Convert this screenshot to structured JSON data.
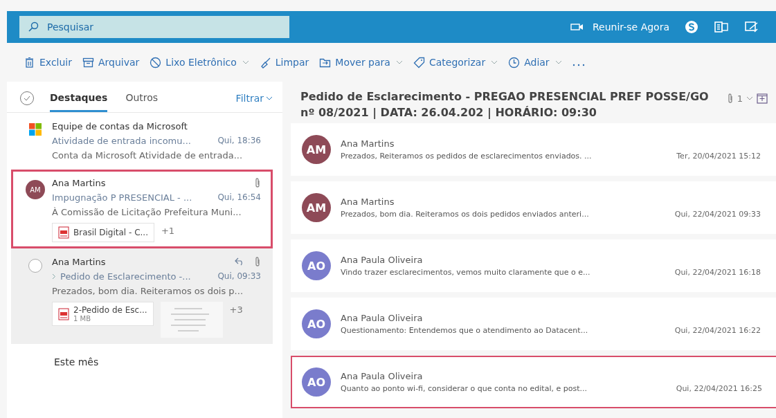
{
  "top_bar": {
    "search": {
      "placeholder": "Pesquisar"
    },
    "meet_now": "Reunir-se Agora"
  },
  "toolbar": [
    {
      "label": "Excluir",
      "caret": false
    },
    {
      "label": "Arquivar",
      "caret": false
    },
    {
      "label": "Lixo Eletrônico",
      "caret": true
    },
    {
      "label": "Limpar",
      "caret": false
    },
    {
      "label": "Mover para",
      "caret": true
    },
    {
      "label": "Categorizar",
      "caret": true
    },
    {
      "label": "Adiar",
      "caret": true
    }
  ],
  "message_list": {
    "tabs": [
      {
        "label": "Destaques",
        "selected": true
      },
      {
        "label": "Outros",
        "selected": false
      }
    ],
    "filter": "Filtrar",
    "items": [
      {
        "kind": "logo",
        "sender": "Equipe de contas da Microsoft",
        "subject": "Atividade de entrada incomu...",
        "time": "Qui, 18:36",
        "preview": "Conta da Microsoft Atividade de entrada...",
        "highlighted": false,
        "attachment": false,
        "replied": false
      },
      {
        "kind": "avatar",
        "initials": "AM",
        "color": "#8e4a57",
        "sender": "Ana Martins",
        "subject": "Impugnação P PRESENCIAL - ...",
        "time": "Qui, 16:54",
        "preview": "À Comissão de Licitação Prefeitura Muni...",
        "highlighted": true,
        "attachment": true,
        "replied": false,
        "files": [
          {
            "kind": "pdf",
            "name": "Brasil Digital - C..."
          }
        ],
        "more": "+1"
      },
      {
        "kind": "radio",
        "sender": "Ana Martins",
        "subject": "Pedido de Esclarecimento -...",
        "time": "Qui, 09:33",
        "preview": "Prezados, bom dia. Reiteramos os dois p...",
        "highlighted": false,
        "attachment": true,
        "replied": true,
        "files": [
          {
            "kind": "pdf",
            "name": "2-Pedido de Esc...",
            "size": "1 MB"
          },
          {
            "kind": "thumbnail"
          }
        ],
        "more": "+3"
      }
    ],
    "section": "Este mês"
  },
  "reading_pane": {
    "subject": "Pedido de Esclarecimento - PREGAO PRESENCIAL PREF POSSE/GO nº 08/2021 | DATA: 26.04.202 | HORÁRIO: 09:30",
    "attachment_count": "1",
    "messages": [
      {
        "initials": "AM",
        "color": "#8e4a57",
        "sender": "Ana Martins",
        "preview": "Prezados, Reiteramos os pedidos de esclarecimentos enviados. ...",
        "date": "Ter, 20/04/2021 15:12",
        "highlighted": false
      },
      {
        "initials": "AM",
        "color": "#8e4a57",
        "sender": "Ana Martins",
        "preview": "Prezados, bom dia. Reiteramos os dois pedidos enviados anteri...",
        "date": "Qui, 22/04/2021 09:33",
        "highlighted": false
      },
      {
        "initials": "AO",
        "color": "#7a7ccc",
        "sender": "Ana Paula Oliveira",
        "preview": "Vindo trazer esclarecimentos, vemos muito claramente que o e...",
        "date": "Qui, 22/04/2021 16:18",
        "highlighted": false
      },
      {
        "initials": "AO",
        "color": "#7a7ccc",
        "sender": "Ana Paula Oliveira",
        "preview": "Questionamento: Entendemos que o atendimento ao Datacent...",
        "date": "Qui, 22/04/2021 16:22",
        "highlighted": false
      },
      {
        "initials": "AO",
        "color": "#7a7ccc",
        "sender": "Ana Paula Oliveira",
        "preview": "Quanto ao ponto wi-fi, considerar o que conta no edital, e post...",
        "date": "Qui, 22/04/2021 16:25",
        "highlighted": true
      }
    ]
  }
}
